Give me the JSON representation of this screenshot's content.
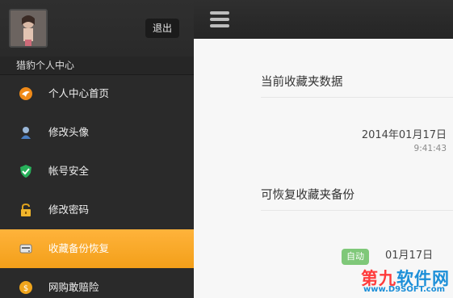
{
  "sidebar": {
    "logout_label": "退出",
    "section_title": "猎豹个人中心",
    "items": [
      {
        "label": "个人中心首页",
        "icon": "orange-swirl-icon",
        "active": false
      },
      {
        "label": "修改头像",
        "icon": "user-icon",
        "active": false
      },
      {
        "label": "帐号安全",
        "icon": "shield-icon",
        "active": false
      },
      {
        "label": "修改密码",
        "icon": "lock-icon",
        "active": false
      },
      {
        "label": "收藏备份恢复",
        "icon": "drive-icon",
        "active": true
      },
      {
        "label": "网购敢赔险",
        "icon": "coin-icon",
        "active": false
      }
    ]
  },
  "header": {
    "menu_icon": "hamburger-icon"
  },
  "main": {
    "current_title": "当前收藏夹数据",
    "current_date": "2014年01月17日",
    "current_time": "9:41:43",
    "backup_title": "可恢复收藏夹备份",
    "backup_badge": "自动",
    "backup_date": "01月17日"
  },
  "watermark": {
    "text_red": "第九",
    "text_blue": "软件网",
    "url": "www.D9SOFT.com"
  },
  "colors": {
    "active": "#f5a21f",
    "sidebar_bg": "#2a2a2a",
    "badge_green": "#7fc879",
    "watermark_blue": "#1c8fd8",
    "watermark_red": "#ff3b3b"
  }
}
